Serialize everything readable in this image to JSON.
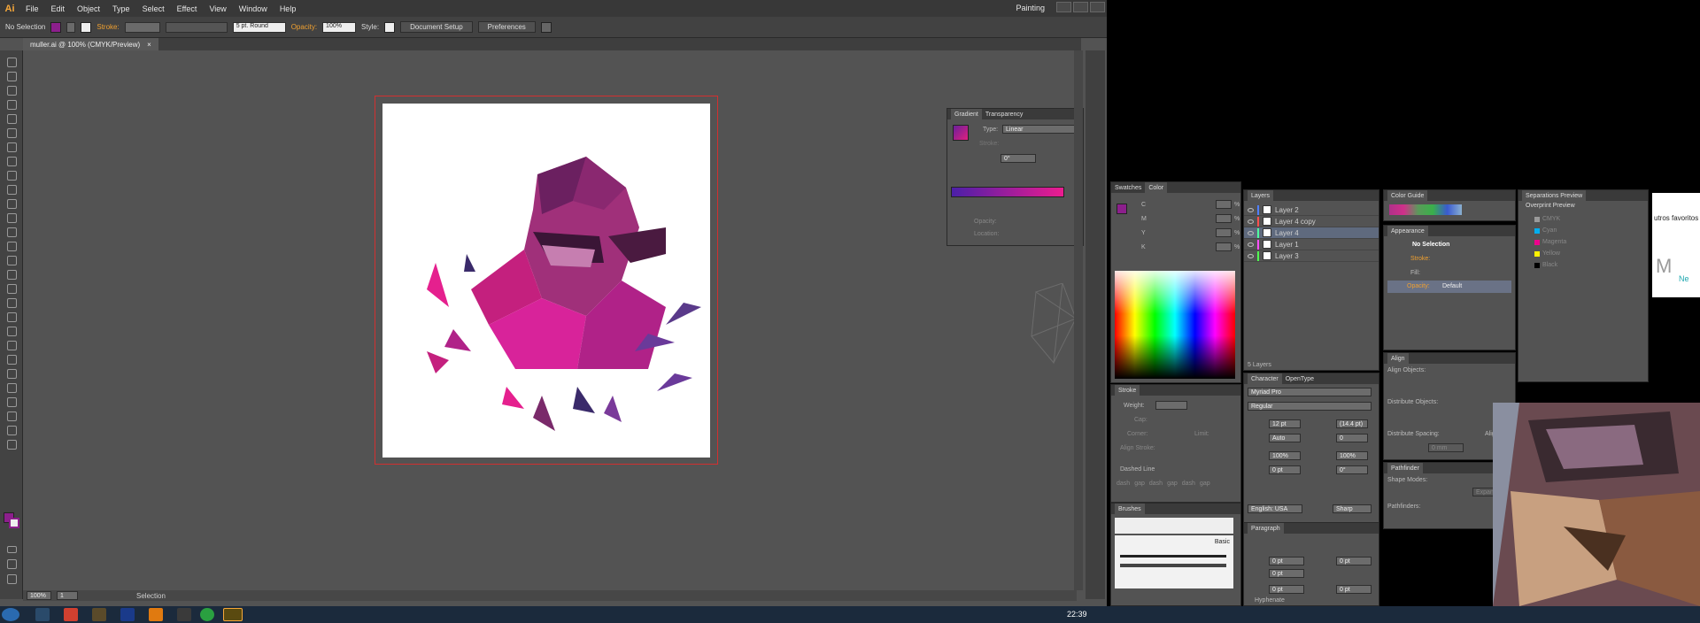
{
  "app": {
    "logo": "Ai",
    "menu": [
      "File",
      "Edit",
      "Object",
      "Type",
      "Select",
      "Effect",
      "View",
      "Window",
      "Help"
    ],
    "workspace": "Painting"
  },
  "control": {
    "selection": "No Selection",
    "stroke_label": "Stroke:",
    "brush": "5 pt. Round",
    "opacity_label": "Opacity:",
    "opacity_value": "100%",
    "style_label": "Style:",
    "doc_setup": "Document Setup",
    "preferences": "Preferences"
  },
  "document": {
    "tab": "muller.ai @ 100% (CMYK/Preview)",
    "close": "×",
    "zoom": "100%",
    "page": "1",
    "status": "Selection"
  },
  "gradient": {
    "tabs": [
      "Gradient",
      "Transparency"
    ],
    "type_label": "Type:",
    "type_value": "Linear",
    "stroke_label": "Stroke:",
    "angle_value": "0°",
    "opacity_label": "Opacity:",
    "location_label": "Location:"
  },
  "color": {
    "tabs": [
      "Swatches",
      "Color"
    ],
    "channels": [
      "C",
      "M",
      "Y",
      "K"
    ],
    "percent": "%"
  },
  "stroke": {
    "title": "Stroke",
    "weight_label": "Weight:",
    "cap_label": "Cap:",
    "corner_label": "Corner:",
    "limit_label": "Limit:",
    "align_label": "Align Stroke:",
    "dashed_label": "Dashed Line",
    "dash_labels": [
      "dash",
      "gap",
      "dash",
      "gap",
      "dash",
      "gap"
    ]
  },
  "brushes": {
    "title": "Brushes",
    "basic": "Basic"
  },
  "layers": {
    "title": "Layers",
    "items": [
      {
        "name": "Layer 2",
        "color": "#4f7fff"
      },
      {
        "name": "Layer 4 copy",
        "color": "#ff4f4f"
      },
      {
        "name": "Layer 4",
        "color": "#4fff9f"
      },
      {
        "name": "Layer 1",
        "color": "#ff4fff"
      },
      {
        "name": "Layer 3",
        "color": "#4fff4f"
      }
    ],
    "count": "5 Layers"
  },
  "character": {
    "tabs": [
      "Character",
      "OpenType"
    ],
    "font": "Myriad Pro",
    "style": "Regular",
    "size": "12 pt",
    "leading": "(14.4 pt)",
    "kerning": "Auto",
    "tracking": "0",
    "vscale": "100%",
    "hscale": "100%",
    "baseline": "0 pt",
    "rotation": "0°",
    "language": "English: USA",
    "aa": "Sharp"
  },
  "paragraph": {
    "title": "Paragraph",
    "indent_left": "0 pt",
    "indent_right": "0 pt",
    "first_line": "0 pt",
    "space_before": "0 pt",
    "space_after": "0 pt",
    "hyphenate": "Hyphenate"
  },
  "color_guide": {
    "title": "Color Guide"
  },
  "appearance": {
    "title": "Appearance",
    "selection": "No Selection",
    "stroke": "Stroke:",
    "fill": "Fill:",
    "opacity": "Opacity:",
    "opacity_value": "Default"
  },
  "align": {
    "title": "Align",
    "objects": "Align Objects:",
    "distribute": "Distribute Objects:",
    "spacing": "Distribute Spacing:",
    "align_to": "Align To:",
    "spacing_value": "0 mm"
  },
  "pathfinder": {
    "title": "Pathfinder",
    "modes": "Shape Modes:",
    "expand": "Expand",
    "finders": "Pathfinders:"
  },
  "separations": {
    "title": "Separations Preview",
    "overprint": "Overprint Preview",
    "inks": [
      {
        "name": "CMYK",
        "color": "#9a9a9a"
      },
      {
        "name": "Cyan",
        "color": "#00aeef"
      },
      {
        "name": "Magenta",
        "color": "#ec008c"
      },
      {
        "name": "Yellow",
        "color": "#fff200"
      },
      {
        "name": "Black",
        "color": "#000000"
      }
    ]
  },
  "browser": {
    "text": "utros favoritos",
    "letter": "M",
    "partial": "Ne"
  },
  "taskbar": {
    "time": "22:39"
  },
  "colors": {
    "accent_orange": "#f7a83a",
    "gradient_start": "#4b1fa8",
    "gradient_end": "#ec1c8f",
    "fill": "#8c1f8c"
  }
}
